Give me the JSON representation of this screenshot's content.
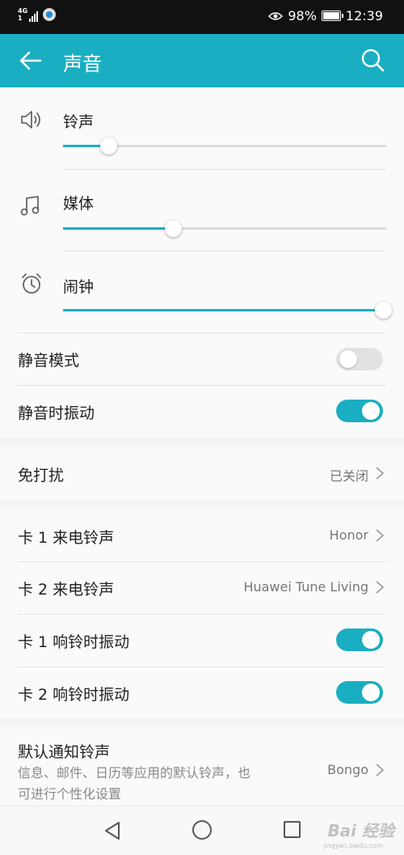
{
  "status_bar": {
    "network": "4G",
    "network_sub": "1",
    "battery_percent": "98%",
    "time": "12:39"
  },
  "app_bar": {
    "title": "声音",
    "accent_color": "#1aaec3"
  },
  "volumes": [
    {
      "label": "铃声",
      "icon": "speaker-icon",
      "level": 0.14
    },
    {
      "label": "媒体",
      "icon": "music-note-icon",
      "level": 0.34
    },
    {
      "label": "闹钟",
      "icon": "alarm-clock-icon",
      "level": 0.99
    }
  ],
  "silent_mode": {
    "label": "静音模式",
    "on": false
  },
  "vibrate_when_silent": {
    "label": "静音时振动",
    "on": true
  },
  "do_not_disturb": {
    "label": "免打扰",
    "value": "已关闭"
  },
  "ringtones": {
    "sim1_ringtone": {
      "label": "卡 1 来电铃声",
      "value": "Honor"
    },
    "sim2_ringtone": {
      "label": "卡 2 来电铃声",
      "value": "Huawei Tune Living"
    },
    "sim1_vibrate": {
      "label": "卡 1 响铃时振动",
      "on": true
    },
    "sim2_vibrate": {
      "label": "卡 2 响铃时振动",
      "on": true
    }
  },
  "notification_tone": {
    "label": "默认通知铃声",
    "description": "信息、邮件、日历等应用的默认铃声，也可进行个性化设置",
    "value": "Bongo"
  },
  "watermark": {
    "text": "Bai 经验",
    "sub": "jingyan.baidu.com"
  }
}
